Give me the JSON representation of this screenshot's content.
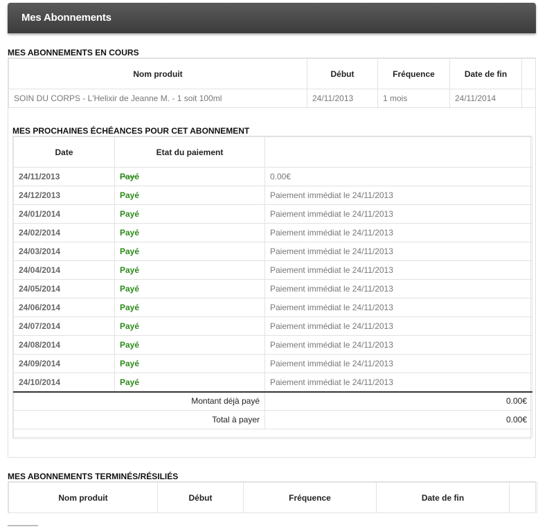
{
  "header": {
    "title": "Mes Abonnements"
  },
  "current": {
    "section_title": "MES ABONNEMENTS EN COURS",
    "columns": [
      "Nom produit",
      "Début",
      "Fréquence",
      "Date de fin"
    ],
    "rows": [
      {
        "product": "SOIN DU CORPS - L'Helixir de Jeanne M. - 1 soit 100ml",
        "start": "24/11/2013",
        "frequency": "1 mois",
        "end": "24/11/2014"
      }
    ]
  },
  "schedule": {
    "section_title": "MES PROCHAINES ÉCHÉANCES POUR CET ABONNEMENT",
    "columns": [
      "Date",
      "Etat du paiement",
      ""
    ],
    "rows": [
      {
        "date": "24/11/2013",
        "status": "Payé",
        "detail": "0.00€"
      },
      {
        "date": "24/12/2013",
        "status": "Payé",
        "detail": "Paiement immédiat le 24/11/2013"
      },
      {
        "date": "24/01/2014",
        "status": "Payé",
        "detail": "Paiement immédiat le 24/11/2013"
      },
      {
        "date": "24/02/2014",
        "status": "Payé",
        "detail": "Paiement immédiat le 24/11/2013"
      },
      {
        "date": "24/03/2014",
        "status": "Payé",
        "detail": "Paiement immédiat le 24/11/2013"
      },
      {
        "date": "24/04/2014",
        "status": "Payé",
        "detail": "Paiement immédiat le 24/11/2013"
      },
      {
        "date": "24/05/2014",
        "status": "Payé",
        "detail": "Paiement immédiat le 24/11/2013"
      },
      {
        "date": "24/06/2014",
        "status": "Payé",
        "detail": "Paiement immédiat le 24/11/2013"
      },
      {
        "date": "24/07/2014",
        "status": "Payé",
        "detail": "Paiement immédiat le 24/11/2013"
      },
      {
        "date": "24/08/2014",
        "status": "Payé",
        "detail": "Paiement immédiat le 24/11/2013"
      },
      {
        "date": "24/09/2014",
        "status": "Payé",
        "detail": "Paiement immédiat le 24/11/2013"
      },
      {
        "date": "24/10/2014",
        "status": "Payé",
        "detail": "Paiement immédiat le 24/11/2013"
      }
    ],
    "already_paid_label": "Montant déjà payé",
    "already_paid_value": "0.00€",
    "total_label": "Total à payer",
    "total_value": "0.00€"
  },
  "ended": {
    "section_title": "MES ABONNEMENTS TERMINÉS/RÉSILIÉS",
    "columns": [
      "Nom produit",
      "Début",
      "Fréquence",
      "Date de fin"
    ]
  },
  "colors": {
    "header_bg": "#4a4a4a",
    "paid_green": "#2c8a1a",
    "border": "#e2e2e2"
  }
}
